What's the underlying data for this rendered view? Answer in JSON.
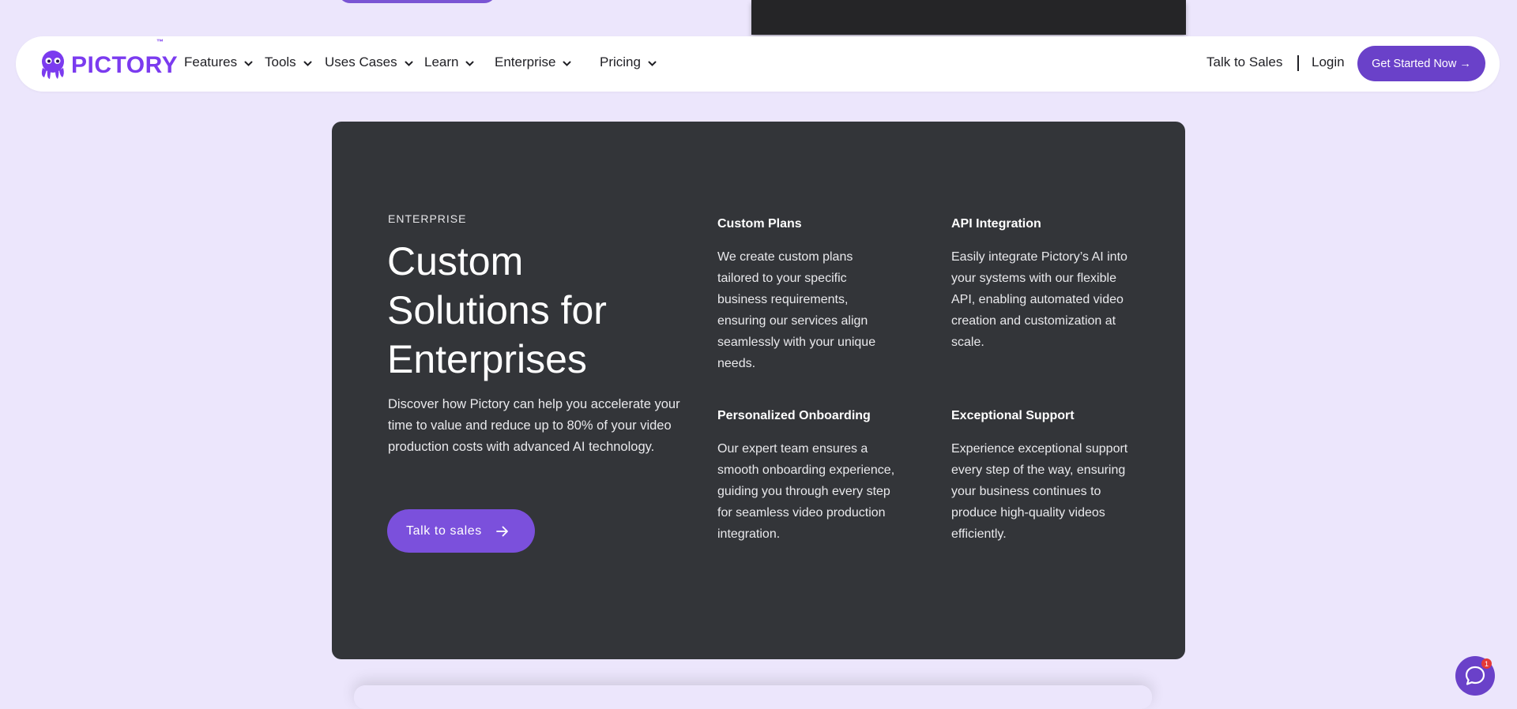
{
  "brand": {
    "name": "PICTORY",
    "trademark": "™",
    "accent_color": "#7b3bef",
    "button_color": "#6a41c9"
  },
  "nav": {
    "items": [
      {
        "label": "Features",
        "icon": "chevron-down-icon"
      },
      {
        "label": "Tools",
        "icon": "chevron-down-icon"
      },
      {
        "label": "Uses Cases",
        "icon": "chevron-down-icon"
      },
      {
        "label": "Learn",
        "icon": "chevron-down-icon"
      },
      {
        "label": "Enterprise",
        "icon": "chevron-down-icon"
      },
      {
        "label": "Pricing",
        "icon": "chevron-down-icon"
      }
    ],
    "talk_to_sales": "Talk to Sales",
    "login": "Login",
    "cta": "Get Started Now →"
  },
  "enterprise": {
    "eyebrow": "ENTERPRISE",
    "headline": "Custom Solutions for Enterprises",
    "intro": "Discover how Pictory can help you accelerate your time to value and reduce up to 80% of your video production costs with advanced AI technology.",
    "cta": "Talk to sales",
    "features": [
      {
        "title": "Custom Plans",
        "body": "We create custom plans tailored to your specific business requirements, ensuring our services align seamlessly with your unique needs."
      },
      {
        "title": "API Integration",
        "body": "Easily integrate Pictory’s AI into your systems with our flexible API, enabling automated video creation and customization at scale."
      },
      {
        "title": "Personalized Onboarding",
        "body": "Our expert team ensures a smooth onboarding experience, guiding you through every step for seamless video production integration."
      },
      {
        "title": "Exceptional Support",
        "body": "Experience exceptional support every step of the way, ensuring your business continues to produce high-quality videos efficiently."
      }
    ]
  },
  "chat": {
    "icon": "chat-bubble-icon",
    "badge": "1"
  }
}
